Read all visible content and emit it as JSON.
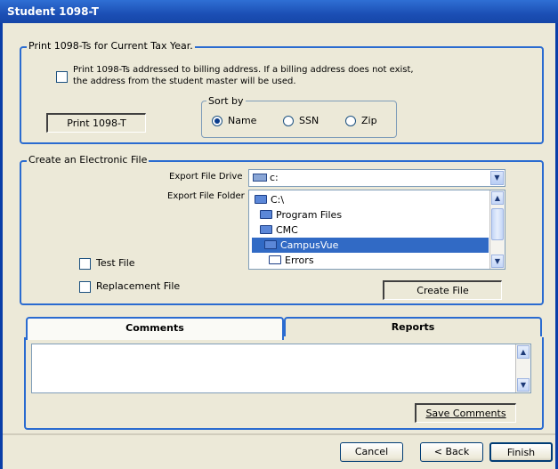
{
  "window": {
    "title": "Student 1098-T"
  },
  "print_group": {
    "legend": "Print 1098-Ts for Current Tax Year.",
    "billing_checkbox_label_line1": "Print 1098-Ts addressed to billing address. If a billing address does not exist,",
    "billing_checkbox_label_line2": "the address from the student master will be used.",
    "print_button": "Print 1098-T",
    "sort_by": {
      "legend": "Sort by",
      "options": [
        {
          "label": "Name",
          "selected": true
        },
        {
          "label": "SSN",
          "selected": false
        },
        {
          "label": "Zip",
          "selected": false
        }
      ]
    }
  },
  "electronic_group": {
    "legend": "Create an Electronic File",
    "export_drive_label": "Export File Drive",
    "export_drive_value": "c:",
    "export_folder_label": "Export File Folder",
    "folders": [
      "C:\\",
      "Program Files",
      "CMC",
      "CampusVue",
      "Errors"
    ],
    "selected_folder_index": 3,
    "test_file_label": "Test File",
    "replacement_file_label": "Replacement File",
    "create_file_button": "Create File"
  },
  "tabs": {
    "comments": "Comments",
    "reports": "Reports"
  },
  "comments": {
    "text": "",
    "save_button": "Save Comments"
  },
  "footer": {
    "cancel": "Cancel",
    "back": "< Back",
    "finish": "Finish"
  }
}
